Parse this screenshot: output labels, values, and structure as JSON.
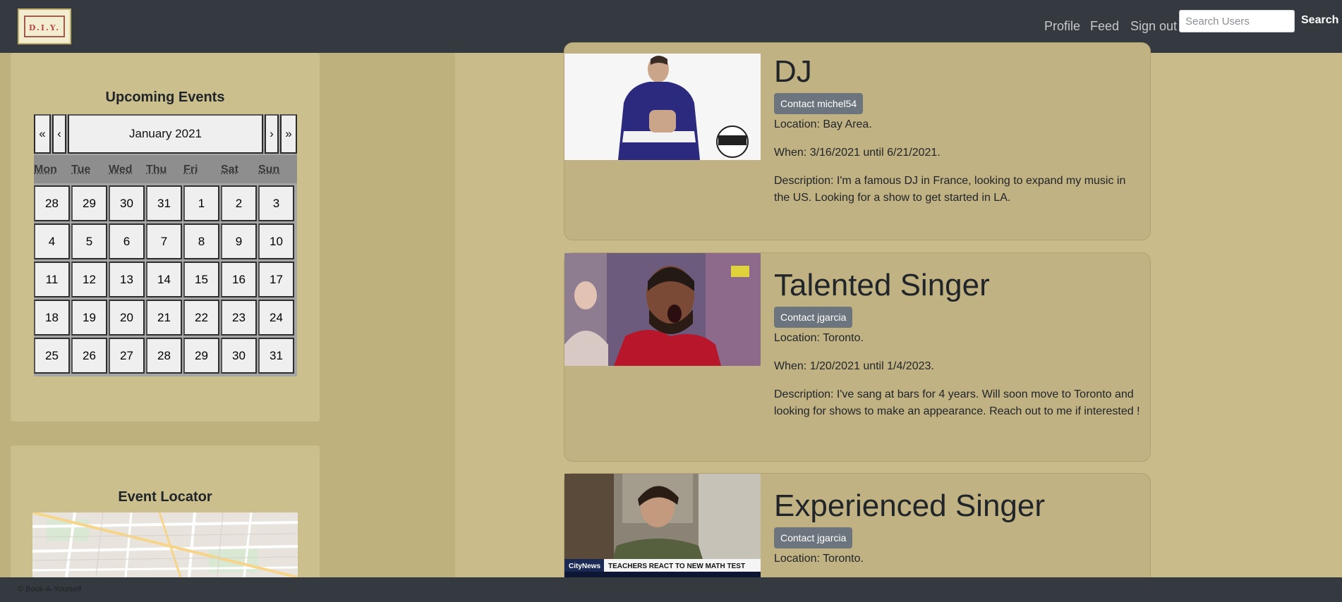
{
  "navbar": {
    "logo_text": "D.I.Y.",
    "links": [
      "Profile",
      "Feed",
      "Sign out"
    ],
    "search_placeholder": "Search Users",
    "search_label": "Search"
  },
  "sidebar": {
    "events_title": "Upcoming Events",
    "calendar": {
      "prev_year": "«",
      "prev_month": "‹",
      "month_label": "January 2021",
      "next_month": "›",
      "next_year": "»",
      "weekdays": [
        "Mon",
        "Tue",
        "Wed",
        "Thu",
        "Fri",
        "Sat",
        "Sun"
      ],
      "weeks": [
        [
          "28",
          "29",
          "30",
          "31",
          "1",
          "2",
          "3"
        ],
        [
          "4",
          "5",
          "6",
          "7",
          "8",
          "9",
          "10"
        ],
        [
          "11",
          "12",
          "13",
          "14",
          "15",
          "16",
          "17"
        ],
        [
          "18",
          "19",
          "20",
          "21",
          "22",
          "23",
          "24"
        ],
        [
          "25",
          "26",
          "27",
          "28",
          "29",
          "30",
          "31"
        ]
      ]
    },
    "locator_title": "Event Locator"
  },
  "posts": [
    {
      "title": "DJ",
      "contact": "Contact michel54",
      "location": "Location: Bay Area.",
      "when": "When: 3/16/2021 until 6/21/2021.",
      "description": "Description: I'm a famous DJ in France, looking to expand my music in the US. Looking for a show to get started in LA."
    },
    {
      "title": "Talented Singer",
      "contact": "Contact jgarcia",
      "location": "Location: Toronto.",
      "when": "When: 1/20/2021 until 1/4/2023.",
      "description": "Description: I've sang at bars for 4 years. Will soon move to Toronto and looking for shows to make an appearance. Reach out to me if interested !"
    },
    {
      "title": "Experienced Singer",
      "contact": "Contact jgarcia",
      "location": "Location: Toronto.",
      "image_caption": "TEACHERS REACT TO NEW MATH TEST",
      "image_brand": "CityNews"
    }
  ],
  "footer": {
    "text": "© Book-A-Yourself"
  }
}
